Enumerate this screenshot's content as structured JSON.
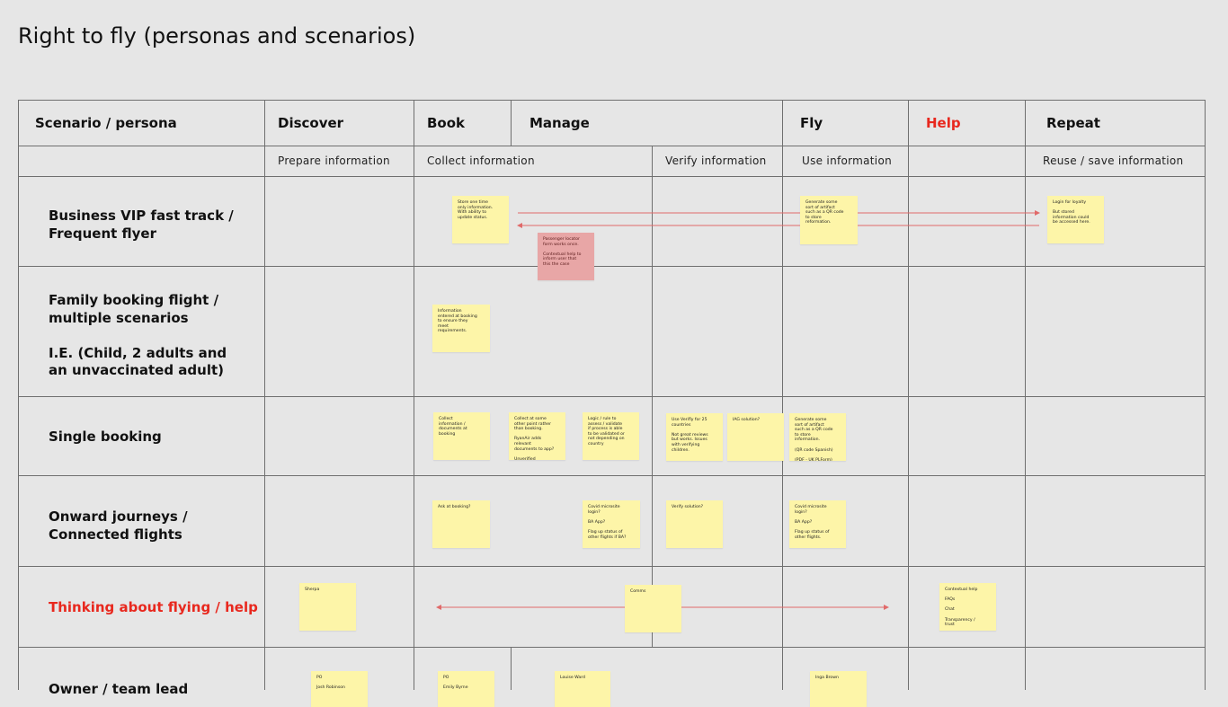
{
  "title": "Right to fly (personas and scenarios)",
  "colors": {
    "accent_red": "#e8281e",
    "sticky_yellow": "#fdf5a8",
    "sticky_pink": "#e8a6a6",
    "background": "#e6e6e6"
  },
  "header": {
    "persona": "Scenario / persona",
    "discover": "Discover",
    "book": "Book",
    "manage": "Manage",
    "fly": "Fly",
    "help": "Help",
    "repeat": "Repeat"
  },
  "subheader": {
    "prepare": "Prepare information",
    "collect": "Collect information",
    "verify": "Verify information",
    "use": "Use information",
    "reuse": "Reuse / save information"
  },
  "rows": {
    "r1": "Business VIP fast track /\nFrequent flyer",
    "r2": "Family booking flight /\nmultiple scenarios\n\nI.E. (Child, 2 adults and\nan unvaccinated adult)",
    "r3": "Single booking",
    "r4": "Onward journeys /\nConnected flights",
    "r5": "Thinking about flying / help",
    "r6": "Owner / team lead"
  },
  "notes": {
    "n1": "Store one time\nonly information.\nWith ability to\nupdate status.",
    "n2": "Passenger locator\nform works once.\n\nContextual help to\ninform user that\nthis the case",
    "n3": "Generate some\nsort of artifact\nsuch as a QR code\nto store\nreformation.",
    "n4": "Login for loyalty\n\nBut stored\ninformation could\nbe accessed here.",
    "n5": "Information\nentered at booking\nto ensure they\nmeet\nrequirements.",
    "n6": "Collect\ninformation /\ndocuments at\nbooking",
    "n7": "Collect at some\nother point rather\nthan booking.\n\nRyanAir adds\nrelevant\ndocuments to app?\n\nUnverified",
    "n8": "Logic / rule to\nassess / validate\nif process is able\nto be validated or\nnot depending on\ncountry",
    "n9": "Use Verifly for 25\ncountries\n\nNot great reviews\nbut works. Issues\nwith verifying\nchildren.",
    "n10": "IAG solution?",
    "n11": "Generate some\nsort of artifact\nsuch as a QR code\nto store\ninformation.\n\n(QR code Spanish)\n\n(PDF - UK PLForm)",
    "n12": "Ask at booking?",
    "n13": "Covid microsite\nlogin?\n\nBA App?\n\nFlag up status of\nother flights if BA?",
    "n14": "Verify solution?",
    "n15": "Covid microsite\nlogin?\n\nBA App?\n\nFlag up status of\nother flights.",
    "n16": "Sherpa",
    "n17": "Comms",
    "n18": "Contextual help\n\nFAQs\n\nChat\n\nTransparency /\ntrust",
    "n19": "PO\n\nJosh Robinson",
    "n20": "PO\n\nEmily Byrne",
    "n21": "Louise Ward",
    "n22": "Inga Brown"
  }
}
